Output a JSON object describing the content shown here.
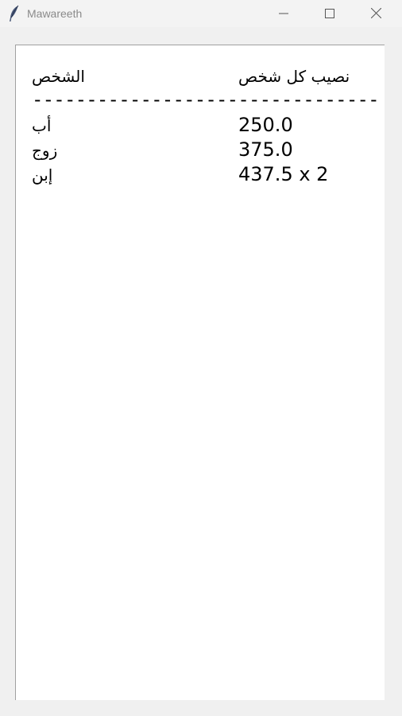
{
  "window": {
    "title": "Mawareeth",
    "icon": "feather-icon",
    "controls": {
      "minimize": "minimize-icon",
      "maximize": "maximize-icon",
      "close": "close-icon"
    }
  },
  "table": {
    "header_person": "الشخص",
    "header_share": "نصيب كل شخص",
    "separator": "--------------------------------",
    "rows": [
      {
        "person": "أب",
        "share": "250.0"
      },
      {
        "person": "زوج",
        "share": "375.0"
      },
      {
        "person": "إبن",
        "share": "437.5 x 2"
      }
    ]
  },
  "colors": {
    "background": "#f0f0f0",
    "content": "#ffffff",
    "title_text": "#8a8a8a"
  }
}
